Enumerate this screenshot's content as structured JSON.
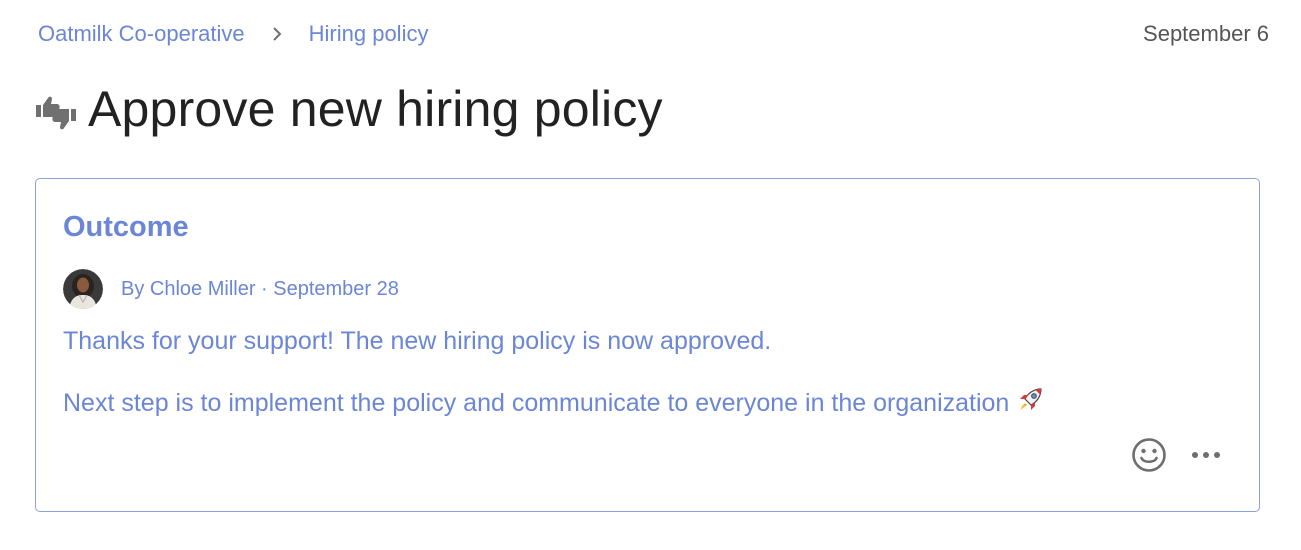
{
  "breadcrumb": {
    "items": [
      {
        "label": "Oatmilk Co-operative"
      },
      {
        "label": "Hiring policy"
      }
    ]
  },
  "header": {
    "date": "September 6"
  },
  "page": {
    "title": "Approve new hiring policy",
    "title_icon": "thumbs-up-down-icon"
  },
  "outcome": {
    "heading": "Outcome",
    "author_line": "By Chloe Miller · September 28",
    "paragraphs": [
      "Thanks for your support! The new hiring policy is now approved.",
      "Next step is to implement the policy and communicate to everyone in the organization"
    ],
    "paragraph_emoji": "rocket-icon",
    "actions": [
      "add-reaction-icon",
      "more-options-icon"
    ]
  },
  "colors": {
    "accent": "#6b86d6",
    "card_border": "#8ca0dc",
    "muted": "#555555",
    "title": "#222222"
  }
}
